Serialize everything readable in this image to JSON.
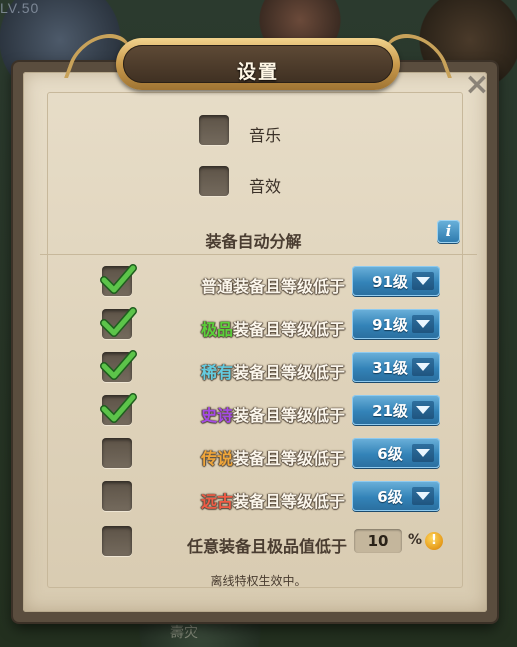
{
  "background": {
    "level_text": "LV.50",
    "bottom_text": "壽灾"
  },
  "title": "设置",
  "close_icon": "×",
  "toggles": {
    "music": {
      "label": "音乐",
      "checked": false
    },
    "sfx": {
      "label": "音效",
      "checked": false
    }
  },
  "auto_dismantle": {
    "title": "装备自动分解",
    "info_icon": "i",
    "rows": [
      {
        "quality": "普通",
        "quality_color": "#fbf6ec",
        "suffix": "装备且等级低于",
        "level": "91级",
        "checked": true
      },
      {
        "quality": "极品",
        "quality_color": "#5bd03a",
        "suffix": "装备且等级低于",
        "level": "91级",
        "checked": true
      },
      {
        "quality": "稀有",
        "quality_color": "#63cbe0",
        "suffix": "装备且等级低于",
        "level": "31级",
        "checked": true
      },
      {
        "quality": "史诗",
        "quality_color": "#a54ae6",
        "suffix": "装备且等级低于",
        "level": "21级",
        "checked": true
      },
      {
        "quality": "传说",
        "quality_color": "#f0a63a",
        "suffix": "装备且等级低于",
        "level": "6级",
        "checked": false
      },
      {
        "quality": "远古",
        "quality_color": "#ef5b45",
        "suffix": "装备且等级低于",
        "level": "6级",
        "checked": false
      }
    ],
    "any_row": {
      "label": "任意装备且极品值低于",
      "value": "10",
      "unit": "%",
      "warn_icon": "!",
      "checked": false
    }
  },
  "footer": "离线特权生效中。"
}
